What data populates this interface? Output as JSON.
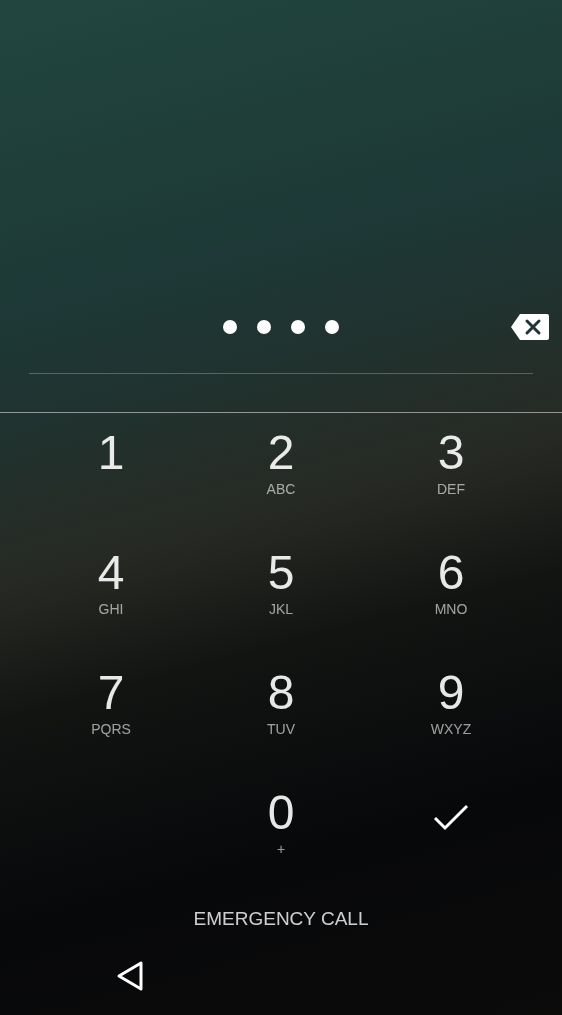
{
  "pin_dots": [
    {
      "filled": true
    },
    {
      "filled": true
    },
    {
      "filled": true
    },
    {
      "filled": true
    }
  ],
  "keys": [
    {
      "kind": "digit",
      "digit": "1"
    },
    {
      "kind": "digit",
      "digit": "2",
      "letters": "ABC"
    },
    {
      "kind": "digit",
      "digit": "3",
      "letters": "DEF"
    },
    {
      "kind": "digit",
      "digit": "4",
      "letters": "GHI"
    },
    {
      "kind": "digit",
      "digit": "5",
      "letters": "JKL"
    },
    {
      "kind": "digit",
      "digit": "6",
      "letters": "MNO"
    },
    {
      "kind": "digit",
      "digit": "7",
      "letters": "PQRS"
    },
    {
      "kind": "digit",
      "digit": "8",
      "letters": "TUV"
    },
    {
      "kind": "digit",
      "digit": "9",
      "letters": "WXYZ"
    },
    {
      "kind": "digit",
      "digit": "0",
      "letters": "+"
    },
    {
      "kind": "enter"
    }
  ],
  "emergency_button": "EMERGENCY CALL"
}
